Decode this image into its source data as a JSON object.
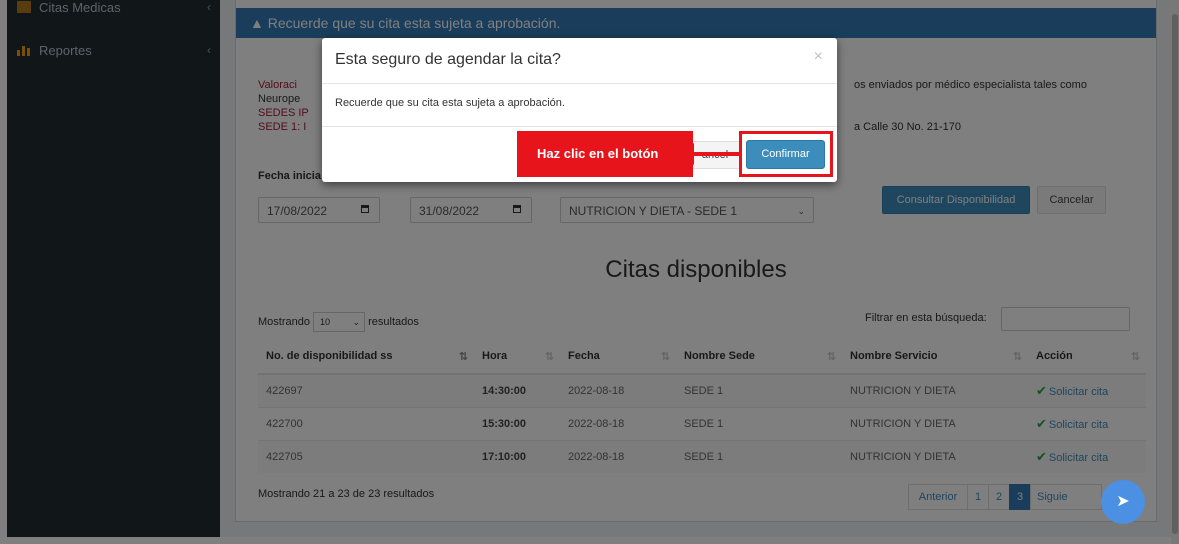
{
  "sidebar": {
    "items": [
      {
        "label": "Citas Medicas",
        "icon": "calendar-icon"
      },
      {
        "label": "Reportes",
        "icon": "bar-chart-icon"
      }
    ]
  },
  "alert": {
    "text": "Recuerde que su cita esta sujeta a aprobación."
  },
  "info": {
    "line1_start": "Valoraci",
    "line1_end": "os enviados por médico especialista tales como",
    "line2": "Neurope",
    "line3": "SEDES IP",
    "line4_start": "SEDE 1: I",
    "line4_end": "a Calle 30 No. 21-170"
  },
  "filters": {
    "fecha_inicial_label": "Fecha inicia",
    "fecha_inicial": "17/08/2022",
    "fecha_final": "31/08/2022",
    "servicio": "NUTRICION Y DIETA - SEDE 1",
    "consultar_label": "Consultar Disponibilidad",
    "cancelar_label": "Cancelar"
  },
  "section_title": "Citas disponibles",
  "table": {
    "length_prefix": "Mostrando",
    "length_value": "10",
    "length_suffix": "resultados",
    "search_label": "Filtrar en esta búsqueda:",
    "columns": [
      "No. de disponibilidad ss",
      "Hora",
      "Fecha",
      "Nombre Sede",
      "Nombre Servicio",
      "Acción"
    ],
    "rows": [
      {
        "id": "422697",
        "hora": "14:30:00",
        "fecha": "2022-08-18",
        "sede": "SEDE 1",
        "servicio": "NUTRICION Y DIETA",
        "accion": "Solicitar cita"
      },
      {
        "id": "422700",
        "hora": "15:30:00",
        "fecha": "2022-08-18",
        "sede": "SEDE 1",
        "servicio": "NUTRICION Y DIETA",
        "accion": "Solicitar cita"
      },
      {
        "id": "422705",
        "hora": "17:10:00",
        "fecha": "2022-08-18",
        "sede": "SEDE 1",
        "servicio": "NUTRICION Y DIETA",
        "accion": "Solicitar cita"
      }
    ],
    "info": "Mostrando 21 a 23 de 23 resultados",
    "pagination": {
      "prev": "Anterior",
      "pages": [
        "1",
        "2",
        "3"
      ],
      "next": "Siguie"
    }
  },
  "modal": {
    "title": "Esta seguro de agendar la cita?",
    "close": "×",
    "body": "Recuerde que su cita esta sujeta a aprobación.",
    "cancel_peek": "ancel",
    "confirm_label": "Confirmar"
  },
  "callout": {
    "text": "Haz clic en el botón"
  },
  "colors": {
    "primary": "#3c8dbc",
    "callout_red": "#e8141b",
    "sidebar_bg": "#222d32",
    "alert_bg": "#337ab7"
  }
}
